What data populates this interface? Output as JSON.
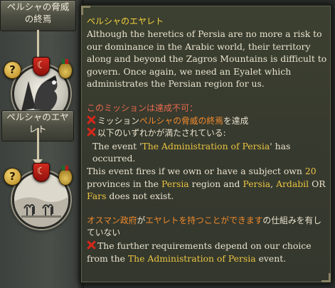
{
  "mission_tree": {
    "node1_title_line1": "ペルシャの脅威",
    "node1_title_line2": "の終焉",
    "node2_title_line1": "ペルシャのエヤ",
    "node2_title_line2": "レト",
    "badge_question": "?",
    "badge_flag": "☾"
  },
  "tooltip": {
    "title": "ペルシャのエヤレト",
    "description": "Although the heretics of Persia are no more a risk to our dominance in the Arabic world, their territory along and beyond the Zagros Mountains is difficult to govern. Once again, we need an Eyalet which administrates the Persian region for us.",
    "unavailable_header": "このミッションは達成不可：",
    "req1_prefix": "ミッション",
    "req1_mission": "ペルシャの脅威の終焉",
    "req1_suffix": "を達成",
    "req2_text": "以下のいずれかが満たされている:",
    "event_prefix": "The event '",
    "event_name": "The Administration of Persia",
    "event_suffix": "' has occurred.",
    "fires_text_1": "This event fires if we own or have a subject own ",
    "fires_count": "20",
    "fires_text_2": " provinces in the ",
    "fires_region": "Persia",
    "fires_text_3": " region and ",
    "fires_tag1": "Persia",
    "fires_sep1": ", ",
    "fires_tag2": "Ardabil",
    "fires_sep2": " OR ",
    "fires_tag3": "Fars",
    "fires_text_4": " does not exist.",
    "ottoman_1": "オスマン政府",
    "ottoman_2": "が",
    "ottoman_3": "エヤレトを持つことができます",
    "ottoman_4": "の仕組みを有していない",
    "further_1": "The further requirements depend on our choice from the ",
    "further_event": "The Administration of Persia",
    "further_2": " event."
  },
  "colors": {
    "title": "#f2d13b",
    "warning_header": "#e86a4e",
    "highlight": "#eac543",
    "orange": "#ef8a2e",
    "x_mark": "#d6271b"
  },
  "icons": [
    "question-badge-icon",
    "crescent-flag-icon",
    "medal-award-icon",
    "x-mark-icon",
    "mission-emblem-icon",
    "camel-caravan-icon"
  ]
}
